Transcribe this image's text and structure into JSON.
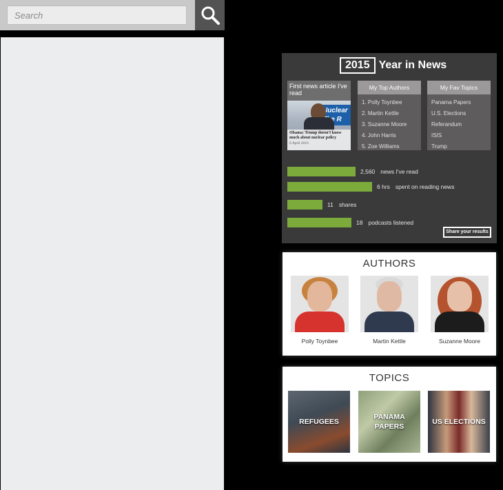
{
  "search": {
    "placeholder": "Search"
  },
  "year_in_news": {
    "year": "2015",
    "title": "Year in News",
    "first_article": {
      "header": "First news article I've read",
      "banner": "Nuclear The R",
      "headline": "Obama: Trump doesn't know much about nuclear policy",
      "date": "6 April 2016"
    },
    "top_authors": {
      "header": "My Top Authors",
      "items": [
        "1. Polly Toynbee",
        "2. Martin Kettle",
        "3. Suzanne Moore",
        "4. John Harris",
        "5. Zoe Williams"
      ]
    },
    "fav_topics": {
      "header": "My Fav Topics",
      "items": [
        "Panama Papers",
        "U.S. Elections",
        "Referandum",
        "ISIS",
        "Trump"
      ]
    },
    "stats": [
      {
        "number": "2,560",
        "label": "news I've read",
        "fill": 0.33
      },
      {
        "number": "6 hrs",
        "label": "spent on reading news",
        "fill": 0.41
      },
      {
        "number": "11",
        "label": "shares",
        "fill": 0.17
      },
      {
        "number": "18",
        "label": "podcasts listened",
        "fill": 0.31
      }
    ],
    "share_label": "Share your results"
  },
  "authors": {
    "title": "AUTHORS",
    "items": [
      {
        "name": "Polly Toynbee"
      },
      {
        "name": "Martin Kettle"
      },
      {
        "name": "Suzanne Moore"
      }
    ]
  },
  "topics": {
    "title": "TOPICS",
    "items": [
      {
        "label": "REFUGEES"
      },
      {
        "label": "PANAMA PAPERS"
      },
      {
        "label": "US ELECTIONS"
      }
    ]
  },
  "colors": {
    "accent_bar": "#7cab3c",
    "panel_dark": "#3b3a3a",
    "page_bg": "#000000"
  }
}
